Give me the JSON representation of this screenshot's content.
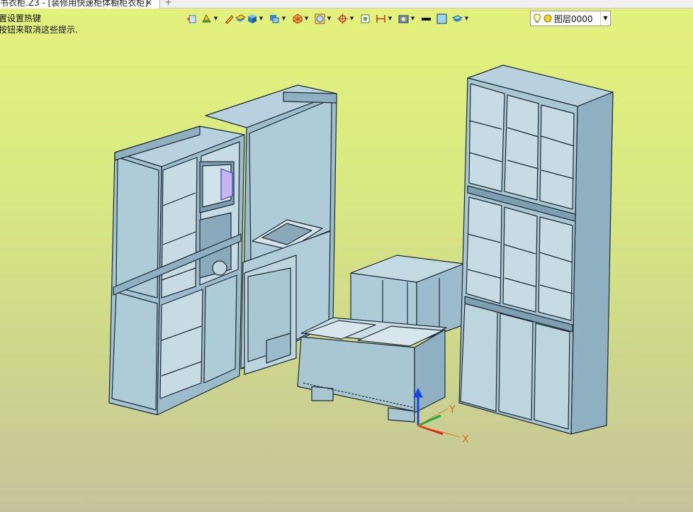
{
  "tab": {
    "title": "书衣柜.Z3 - [装修用快速柜体橱柜衣柜]",
    "close": "✕",
    "add": "+"
  },
  "hints": [
    "置设置热键",
    "按钮来取消这些提示."
  ],
  "toolbar": {
    "icons": [
      "undo-icon",
      "view-icon",
      "pencil-icon",
      "layer-paint-icon",
      "cube-icon",
      "view-cube-icon",
      "wire-icon",
      "sphere-icon",
      "target-icon",
      "box-select-icon",
      "dimension-icon",
      "render-icon",
      "black-line-icon",
      "color-swatch-icon",
      "layers-icon"
    ],
    "layer_name": "图层0000"
  },
  "axes": {
    "x": "X",
    "y": "Y"
  },
  "colors": {
    "cabinet": "#a4c3d2",
    "cabinet_dark": "#86a8b9",
    "edge": "#1c2a33",
    "axis_x": "#e22020",
    "axis_y": "#10b040",
    "axis_z": "#1446e8"
  }
}
